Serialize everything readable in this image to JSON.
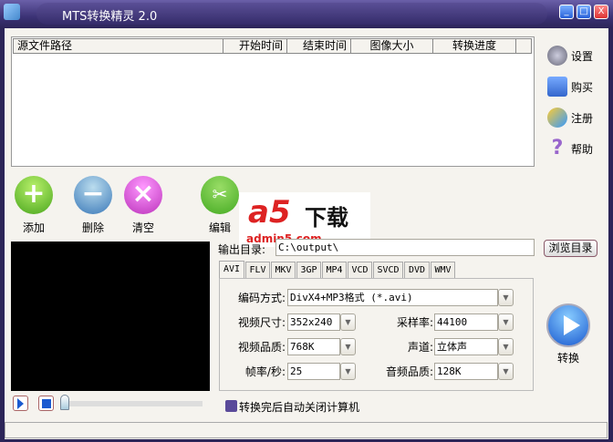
{
  "window": {
    "title": "MTS转换精灵 2.0",
    "minimize": "_",
    "maximize": "□",
    "close": "X"
  },
  "file_list": {
    "columns": [
      "源文件路径",
      "开始时间",
      "结束时间",
      "图像大小",
      "转换进度"
    ],
    "rows": []
  },
  "side_buttons": [
    {
      "label": "设置",
      "icon": "gear-icon"
    },
    {
      "label": "购买",
      "icon": "cart-icon"
    },
    {
      "label": "注册",
      "icon": "key-icon"
    },
    {
      "label": "帮助",
      "icon": "help-icon"
    }
  ],
  "toolbar": {
    "add": "添加",
    "delete": "删除",
    "clear": "清空",
    "edit": "编辑"
  },
  "watermark": {
    "brand": "a5下载",
    "url": "admin5.com"
  },
  "output": {
    "label": "输出目录:",
    "value": "C:\\output\\",
    "browse": "浏览目录"
  },
  "tabs": [
    "AVI",
    "FLV",
    "MKV",
    "3GP",
    "MP4",
    "VCD",
    "SVCD",
    "DVD",
    "WMV"
  ],
  "active_tab": "AVI",
  "settings": {
    "codec": {
      "label": "编码方式:",
      "value": "DivX4+MP3格式 (*.avi)"
    },
    "size": {
      "label": "视频尺寸:",
      "value": "352x240"
    },
    "samplerate": {
      "label": "采样率:",
      "value": "44100"
    },
    "vquality": {
      "label": "视频品质:",
      "value": "768K"
    },
    "channel": {
      "label": "声道:",
      "value": "立体声"
    },
    "fps": {
      "label": "帧率/秒:",
      "value": "25"
    },
    "aquality": {
      "label": "音频品质:",
      "value": "128K"
    }
  },
  "convert": {
    "label": "转换"
  },
  "shutdown": {
    "label": "转换完后自动关闭计算机",
    "checked": false
  },
  "player": {
    "position": 0
  },
  "colors": {
    "titlebar": "#3b3275",
    "body": "#f5f3ee",
    "add": "#5cb82a",
    "delete": "#4a8cc8",
    "clear": "#cc44cc",
    "convert": "#2a6fd6"
  }
}
